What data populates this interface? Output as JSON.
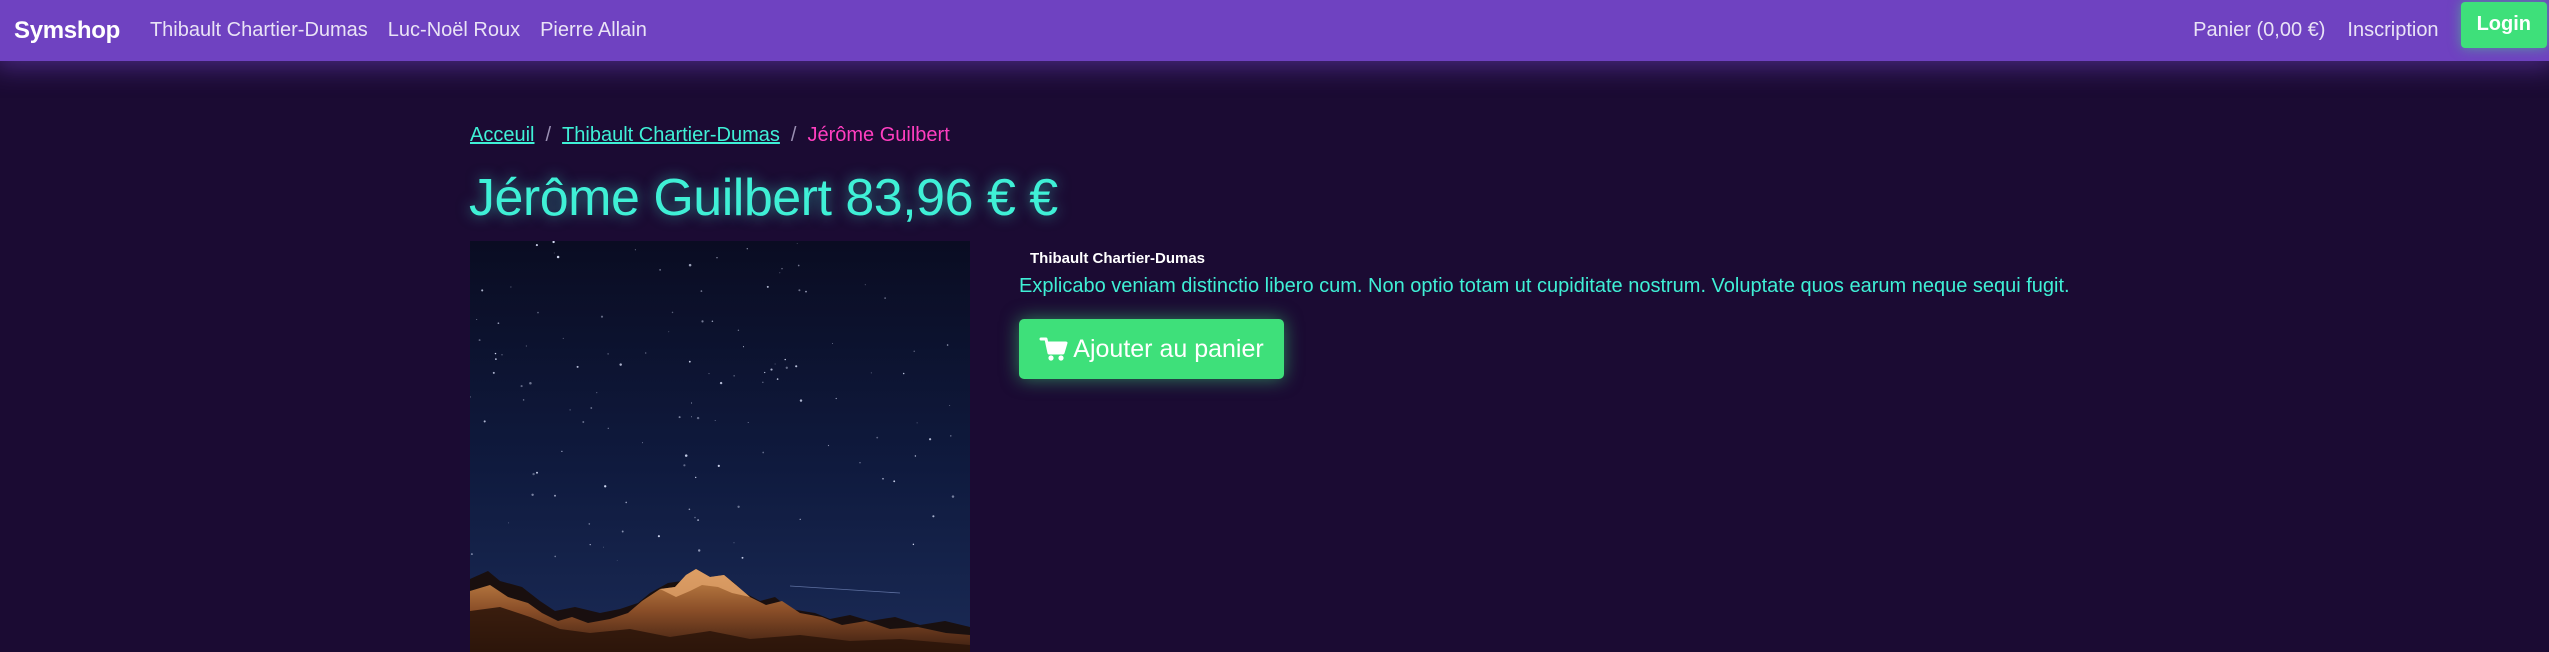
{
  "navbar": {
    "brand": "Symshop",
    "links": [
      {
        "label": "Thibault Chartier-Dumas"
      },
      {
        "label": "Luc-Noël Roux"
      },
      {
        "label": "Pierre Allain"
      }
    ],
    "cart_label": "Panier (0,00 €)",
    "register_label": "Inscription",
    "login_label": "Login"
  },
  "breadcrumb": {
    "home": "Acceuil",
    "category": "Thibault Chartier-Dumas",
    "separator": "/",
    "current": "Jérôme Guilbert"
  },
  "product": {
    "title": "Jérôme Guilbert 83,96 € €",
    "seller": "Thibault Chartier-Dumas",
    "description": "Explicabo veniam distinctio libero cum. Non optio totam ut cupiditate nostrum. Voluptate quos earum neque sequi fugit.",
    "add_to_cart_label": "Ajouter au panier",
    "add_to_cart_icon": "cart-icon"
  },
  "colors": {
    "navbar": "#6f42c1",
    "background": "#1b0b33",
    "accent_cyan": "#3ff0d6",
    "accent_pink": "#ff3ec0",
    "button_green": "#3ee07a"
  }
}
